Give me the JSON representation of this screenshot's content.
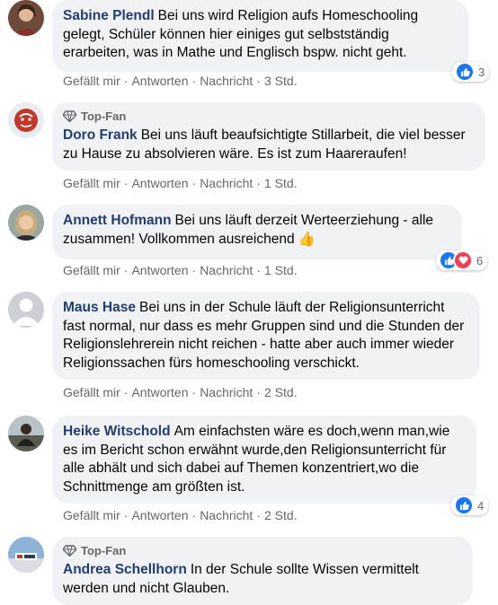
{
  "actions": {
    "like": "Gefällt mir",
    "reply": "Antworten",
    "message": "Nachricht"
  },
  "colors": {
    "author": "#213e6f",
    "bubble": "#f0f2f5",
    "like": "#1877f2",
    "love": "#f33e58"
  },
  "comments": [
    {
      "author": "Sabine Plendl",
      "text": "Bei uns wird Religion aufs Homeschooling gelegt, Schüler können hier einiges gut selbstständig erarbeiten, was in Mathe und Englisch bspw. nicht geht.",
      "time": "3 Std.",
      "reactions": "3"
    },
    {
      "badge": "Top-Fan",
      "author": "Doro Frank",
      "text": "Bei uns läuft beaufsichtigte Stillarbeit, die viel besser zu Hause zu absolvieren wäre. Es ist zum Haareraufen!",
      "time": "1 Std."
    },
    {
      "author": "Annett Hofmann",
      "text": "Bei uns läuft derzeit Werteerziehung - alle zusammen! Vollkommen ausreichend",
      "emoji": "👍",
      "time": "1 Std.",
      "reactions": "6"
    },
    {
      "author": "Maus Hase",
      "text": "Bei uns in der Schule läuft der Religionsunterricht fast normal, nur dass es mehr Gruppen sind und die Stunden der Religionslehrerein nicht reichen - hatte aber auch immer wieder Religionssachen fürs homeschooling verschickt.",
      "time": "2 Std."
    },
    {
      "author": "Heike Witschold",
      "text": "Am einfachsten wäre es doch,wenn man,wie es im Bericht schon erwähnt wurde,den Religionsunterricht für alle abhält und sich dabei auf Themen konzentriert,wo die Schnittmenge am größten ist.",
      "time": "2 Std.",
      "reactions": "4"
    },
    {
      "badge": "Top-Fan",
      "author": "Andrea Schellhorn",
      "text": "In der Schule sollte Wissen vermittelt werden und nicht Glauben."
    }
  ]
}
